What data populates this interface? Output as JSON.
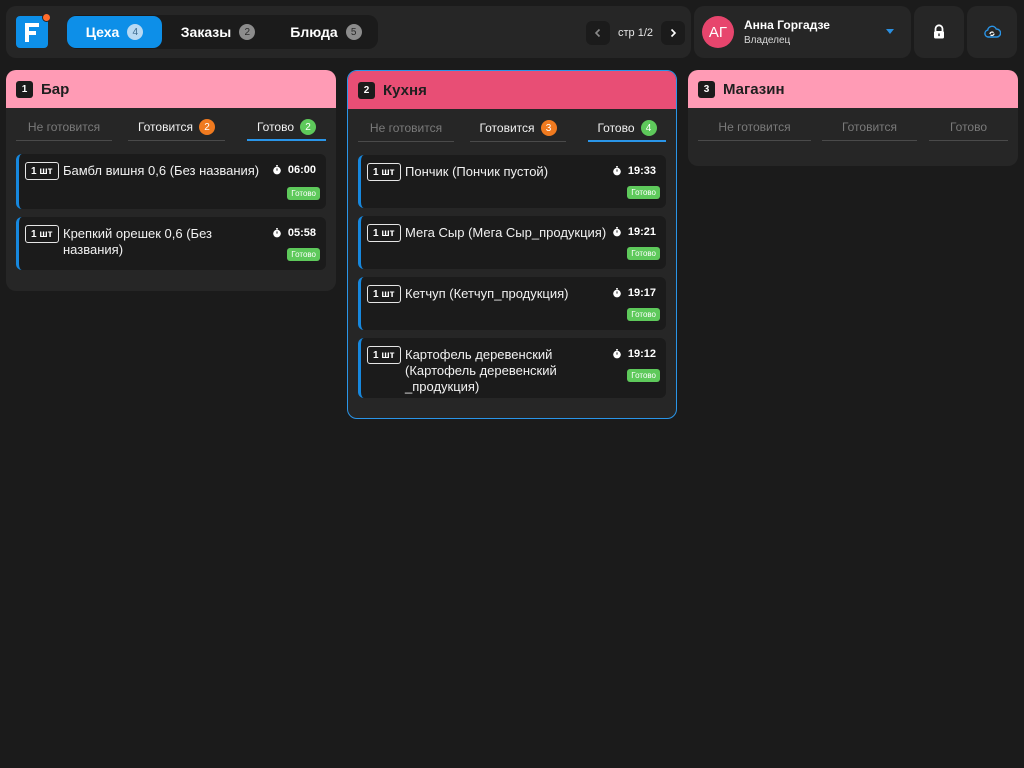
{
  "header": {
    "tabs": [
      {
        "label": "Цеха",
        "count": "4",
        "active": true
      },
      {
        "label": "Заказы",
        "count": "2",
        "active": false
      },
      {
        "label": "Блюда",
        "count": "5",
        "active": false
      }
    ],
    "pager": {
      "text": "стр 1/2"
    },
    "user": {
      "initials": "АГ",
      "name": "Анна Горгадзе",
      "role": "Владелец"
    },
    "icons": {
      "logo": "logo-icon",
      "lock": "lock-icon",
      "cloud": "cloud-sync-icon"
    }
  },
  "columns": [
    {
      "num": "1",
      "title": "Бар",
      "header_color": "#ff9bb5",
      "selected": false,
      "filters": [
        {
          "label": "Не готовится",
          "count": null
        },
        {
          "label": "Готовится",
          "count": "2"
        },
        {
          "label": "Готово",
          "count": "2"
        }
      ],
      "cards": [
        {
          "qty": "1 шт",
          "name": "Бамбл вишня 0,6 (Без названия)",
          "time": "06:00",
          "status": "Готово"
        },
        {
          "qty": "1 шт",
          "name": "Крепкий орешек 0,6 (Без названия)",
          "time": "05:58",
          "status": "Готово"
        }
      ]
    },
    {
      "num": "2",
      "title": "Кухня",
      "header_color": "#e84e75",
      "selected": true,
      "filters": [
        {
          "label": "Не готовится",
          "count": null
        },
        {
          "label": "Готовится",
          "count": "3"
        },
        {
          "label": "Готово",
          "count": "4"
        }
      ],
      "cards": [
        {
          "qty": "1 шт",
          "name": "Пончик (Пончик пустой)",
          "time": "19:33",
          "status": "Готово"
        },
        {
          "qty": "1 шт",
          "name": "Мега Сыр (Мега Сыр_продукция)",
          "time": "19:21",
          "status": "Готово"
        },
        {
          "qty": "1 шт",
          "name": "Кетчуп (Кетчуп_продукция)",
          "time": "19:17",
          "status": "Готово"
        },
        {
          "qty": "1 шт",
          "name": "Картофель деревенский (Картофель деревенский _продукция)",
          "time": "19:12",
          "status": "Готово"
        }
      ]
    },
    {
      "num": "3",
      "title": "Магазин",
      "header_color": "#ff9bb5",
      "selected": false,
      "filters": [
        {
          "label": "Не готовится",
          "count": null
        },
        {
          "label": "Готовится",
          "count": null
        },
        {
          "label": "Готово",
          "count": null
        }
      ],
      "cards": []
    }
  ],
  "colors": {
    "accent": "#0d8fe8",
    "ready": "#5ec95b",
    "cooking": "#f07a1f",
    "avatar": "#e7456d"
  }
}
